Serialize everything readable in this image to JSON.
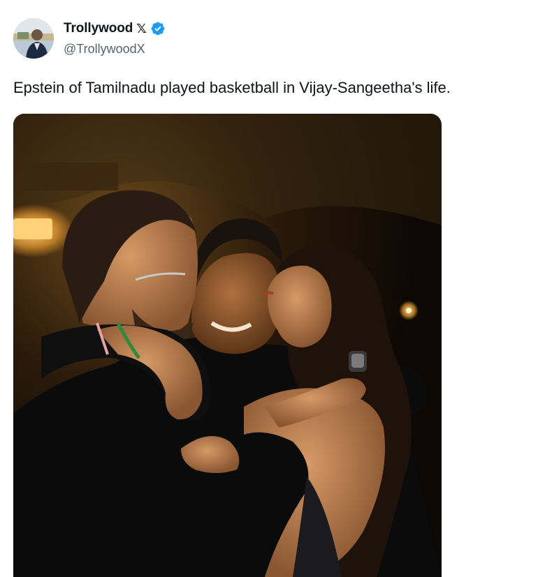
{
  "author": {
    "display_name": "Trollywood",
    "x_badge": "𝕏",
    "handle": "@TrollywoodX",
    "avatar_icon": "profile-photo-man-in-suit",
    "verified_color": "#1d9bf0"
  },
  "tweet": {
    "text": "Epstein of Tamilnadu played basketball in Vijay-Sangeetha's life."
  },
  "media": {
    "type": "photo",
    "icon": "photo-three-people-hugging-night"
  },
  "colors": {
    "text_primary": "#0f1419",
    "text_secondary": "#536471",
    "accent": "#1d9bf0"
  }
}
